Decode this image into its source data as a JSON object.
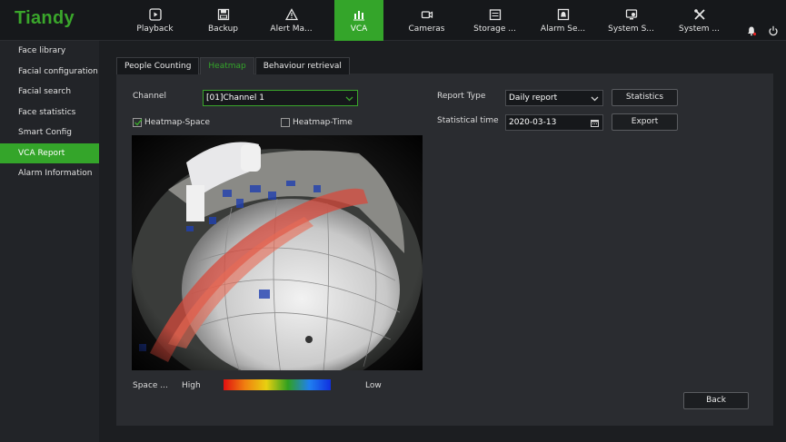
{
  "brand": {
    "logo": "Tiandy",
    "color": "#3aa62b"
  },
  "topnav": [
    {
      "label": "Playback",
      "icon": "playback-icon"
    },
    {
      "label": "Backup",
      "icon": "backup-icon"
    },
    {
      "label": "Alert Ma...",
      "icon": "alert-icon"
    },
    {
      "label": "VCA",
      "icon": "vca-icon",
      "active": true
    },
    {
      "label": "Cameras",
      "icon": "camera-icon"
    },
    {
      "label": "Storage ...",
      "icon": "storage-icon"
    },
    {
      "label": "Alarm Se...",
      "icon": "alarm-icon"
    },
    {
      "label": "System S...",
      "icon": "system-settings-icon"
    },
    {
      "label": "System ...",
      "icon": "system-tools-icon"
    }
  ],
  "sidebar": {
    "items": [
      {
        "label": "Face library"
      },
      {
        "label": "Facial configuration"
      },
      {
        "label": "Facial search"
      },
      {
        "label": "Face statistics"
      },
      {
        "label": "Smart Config"
      },
      {
        "label": "VCA Report",
        "active": true
      },
      {
        "label": "Alarm Information"
      }
    ]
  },
  "tabs": [
    {
      "label": "People Counting"
    },
    {
      "label": "Heatmap",
      "active": true
    },
    {
      "label": "Behaviour retrieval"
    }
  ],
  "form": {
    "channel_label": "Channel",
    "channel_value": "[01]Channel 1",
    "heatmap_space_label": "Heatmap-Space",
    "heatmap_space_checked": true,
    "heatmap_time_label": "Heatmap-Time",
    "heatmap_time_checked": false,
    "report_type_label": "Report Type",
    "report_type_value": "Daily report",
    "statistical_time_label": "Statistical time",
    "statistical_time_value": "2020-03-13",
    "statistics_button": "Statistics",
    "export_button": "Export"
  },
  "legend": {
    "label": "Space ...",
    "high": "High",
    "low": "Low"
  },
  "back_button": "Back",
  "colors": {
    "accent": "#34a52a"
  }
}
